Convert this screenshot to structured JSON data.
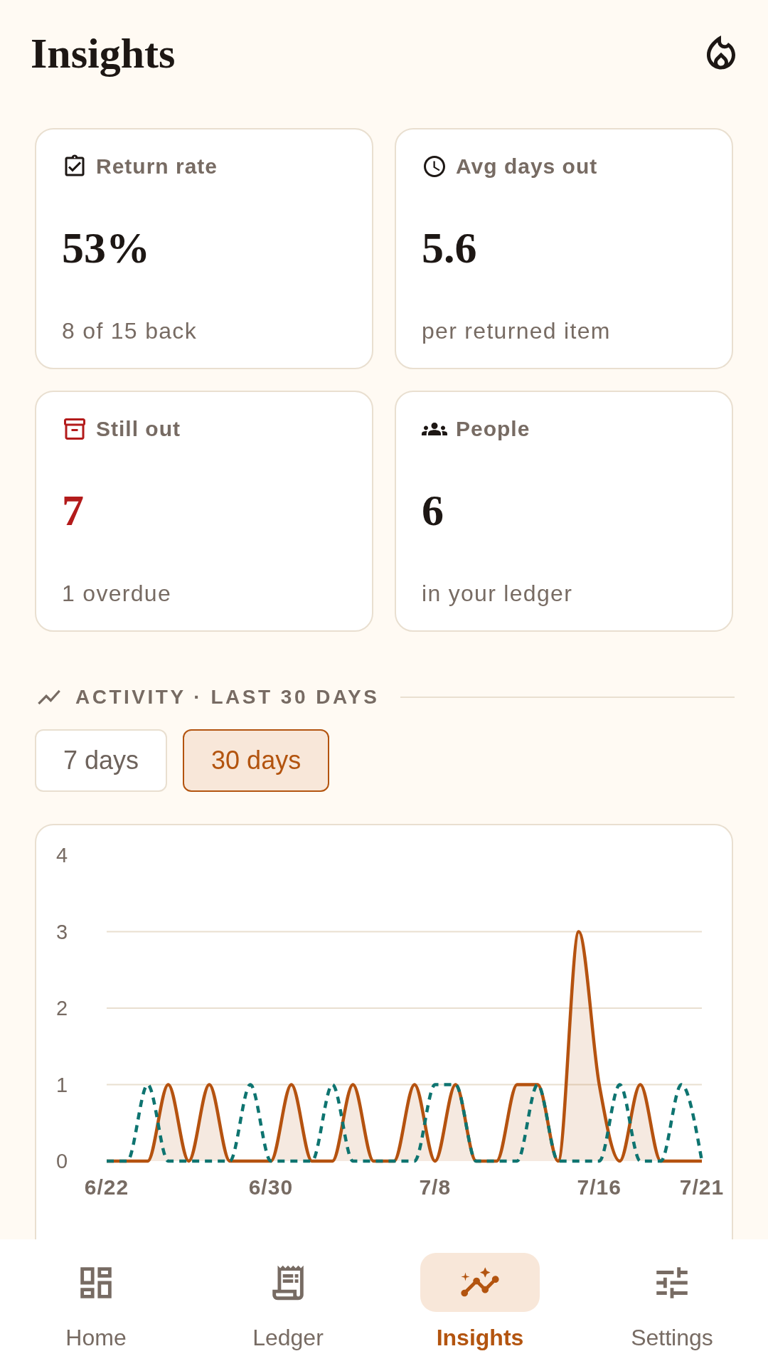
{
  "header": {
    "title": "Insights"
  },
  "stats": [
    {
      "label": "Return rate",
      "value": "53%",
      "caption": "8 of 15 back",
      "alert": false
    },
    {
      "label": "Avg days out",
      "value": "5.6",
      "caption": "per returned item",
      "alert": false
    },
    {
      "label": "Still out",
      "value": "7",
      "caption": "1 overdue",
      "alert": true
    },
    {
      "label": "People",
      "value": "6",
      "caption": "in your ledger",
      "alert": false
    }
  ],
  "activity": {
    "title": "ACTIVITY · LAST 30 DAYS",
    "ranges": [
      {
        "label": "7 days",
        "selected": false
      },
      {
        "label": "30 days",
        "selected": true
      }
    ],
    "chart_data": {
      "type": "area",
      "categories": [
        "6/22",
        null,
        null,
        null,
        null,
        null,
        null,
        null,
        "6/30",
        null,
        null,
        null,
        null,
        null,
        null,
        null,
        "7/8",
        null,
        null,
        null,
        null,
        null,
        null,
        null,
        "7/16",
        null,
        null,
        null,
        null,
        "7/21"
      ],
      "ylim": [
        0,
        4
      ],
      "yticks": [
        0,
        1,
        2,
        3,
        4
      ],
      "grid": true,
      "series": [
        {
          "type": "area",
          "line_style": "solid",
          "color": "#b5520f",
          "values": [
            0,
            0,
            0,
            1,
            0,
            1,
            0,
            0,
            0,
            1,
            0,
            0,
            1,
            0,
            0,
            1,
            0,
            1,
            0,
            0,
            1,
            1,
            0,
            3,
            1,
            0,
            1,
            0,
            0,
            0
          ]
        },
        {
          "type": "line",
          "line_style": "dashed",
          "color": "#0e7470",
          "values": [
            0,
            0,
            1,
            0,
            0,
            0,
            0,
            1,
            0,
            0,
            0,
            1,
            0,
            0,
            0,
            0,
            1,
            1,
            0,
            0,
            0,
            1,
            0,
            0,
            0,
            1,
            0,
            0,
            1,
            0
          ]
        }
      ]
    }
  },
  "nav": [
    {
      "label": "Home",
      "selected": false
    },
    {
      "label": "Ledger",
      "selected": false
    },
    {
      "label": "Insights",
      "selected": true
    },
    {
      "label": "Settings",
      "selected": false
    }
  ]
}
